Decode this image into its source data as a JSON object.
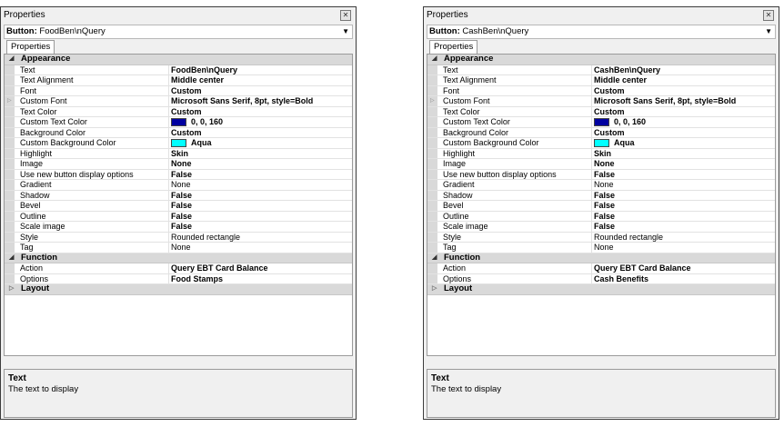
{
  "panels": [
    {
      "title": "Properties",
      "selector": {
        "type": "Button:",
        "name": "FoodBen\\nQuery"
      },
      "tab": "Properties",
      "categories": [
        {
          "name": "Appearance",
          "rows": [
            {
              "name": "Text",
              "value": "FoodBen\\nQuery",
              "bold": true
            },
            {
              "name": "Text Alignment",
              "value": "Middle center",
              "bold": true
            },
            {
              "name": "Font",
              "value": "Custom",
              "bold": true
            },
            {
              "name": "Custom Font",
              "value": "Microsoft Sans Serif, 8pt, style=Bold",
              "bold": true,
              "expandable": true
            },
            {
              "name": "Text Color",
              "value": "Custom",
              "bold": true
            },
            {
              "name": "Custom Text Color",
              "value": "0, 0, 160",
              "bold": true,
              "swatch": "#0000a0"
            },
            {
              "name": "Background Color",
              "value": "Custom",
              "bold": true
            },
            {
              "name": "Custom Background Color",
              "value": "Aqua",
              "bold": true,
              "swatch": "#00ffff"
            },
            {
              "name": "Highlight",
              "value": "Skin",
              "bold": true
            },
            {
              "name": "Image",
              "value": "None",
              "bold": true
            },
            {
              "name": "Use new button display options",
              "value": "False",
              "bold": true
            },
            {
              "name": "Gradient",
              "value": "None",
              "bold": false
            },
            {
              "name": "Shadow",
              "value": "False",
              "bold": true
            },
            {
              "name": "Bevel",
              "value": "False",
              "bold": true
            },
            {
              "name": "Outline",
              "value": "False",
              "bold": true
            },
            {
              "name": "Scale image",
              "value": "False",
              "bold": true
            },
            {
              "name": "Style",
              "value": "Rounded rectangle",
              "bold": false
            },
            {
              "name": "Tag",
              "value": "None",
              "bold": false
            }
          ]
        },
        {
          "name": "Function",
          "rows": [
            {
              "name": "Action",
              "value": "Query EBT Card Balance",
              "bold": true
            },
            {
              "name": "Options",
              "value": "Food Stamps",
              "bold": true
            }
          ]
        }
      ],
      "collapsed_category": "Layout",
      "help": {
        "title": "Text",
        "description": "The text to display"
      }
    },
    {
      "title": "Properties",
      "selector": {
        "type": "Button:",
        "name": "CashBen\\nQuery"
      },
      "tab": "Properties",
      "categories": [
        {
          "name": "Appearance",
          "rows": [
            {
              "name": "Text",
              "value": "CashBen\\nQuery",
              "bold": true
            },
            {
              "name": "Text Alignment",
              "value": "Middle center",
              "bold": true
            },
            {
              "name": "Font",
              "value": "Custom",
              "bold": true
            },
            {
              "name": "Custom Font",
              "value": "Microsoft Sans Serif, 8pt, style=Bold",
              "bold": true,
              "expandable": true
            },
            {
              "name": "Text Color",
              "value": "Custom",
              "bold": true
            },
            {
              "name": "Custom Text Color",
              "value": "0, 0, 160",
              "bold": true,
              "swatch": "#0000a0"
            },
            {
              "name": "Background Color",
              "value": "Custom",
              "bold": true
            },
            {
              "name": "Custom Background Color",
              "value": "Aqua",
              "bold": true,
              "swatch": "#00ffff"
            },
            {
              "name": "Highlight",
              "value": "Skin",
              "bold": true
            },
            {
              "name": "Image",
              "value": "None",
              "bold": true
            },
            {
              "name": "Use new button display options",
              "value": "False",
              "bold": true
            },
            {
              "name": "Gradient",
              "value": "None",
              "bold": false
            },
            {
              "name": "Shadow",
              "value": "False",
              "bold": true
            },
            {
              "name": "Bevel",
              "value": "False",
              "bold": true
            },
            {
              "name": "Outline",
              "value": "False",
              "bold": true
            },
            {
              "name": "Scale image",
              "value": "False",
              "bold": true
            },
            {
              "name": "Style",
              "value": "Rounded rectangle",
              "bold": false
            },
            {
              "name": "Tag",
              "value": "None",
              "bold": false
            }
          ]
        },
        {
          "name": "Function",
          "rows": [
            {
              "name": "Action",
              "value": "Query EBT Card Balance",
              "bold": true
            },
            {
              "name": "Options",
              "value": "Cash Benefits",
              "bold": true
            }
          ]
        }
      ],
      "collapsed_category": "Layout",
      "help": {
        "title": "Text",
        "description": "The text to display"
      }
    }
  ]
}
